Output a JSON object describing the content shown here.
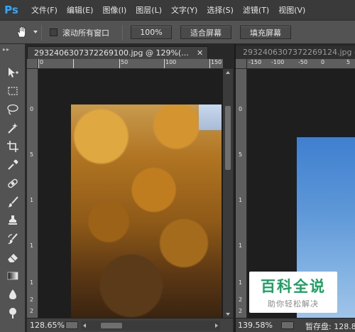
{
  "app": {
    "logo": "Ps"
  },
  "menu": [
    "文件(F)",
    "编辑(E)",
    "图像(I)",
    "图层(L)",
    "文字(Y)",
    "选择(S)",
    "滤镜(T)",
    "视图(V)"
  ],
  "options": {
    "tool_icon": "hand-icon",
    "scroll_all_label": "滚动所有窗口",
    "scroll_all_checked": false,
    "btn_100": "100%",
    "btn_fit": "适合屏幕",
    "btn_fill": "填充屏幕"
  },
  "tools": [
    "move-icon",
    "marquee-icon",
    "lasso-icon",
    "magic-wand-icon",
    "crop-icon",
    "eyedropper-icon",
    "healing-brush-icon",
    "brush-icon",
    "clone-stamp-icon",
    "history-brush-icon",
    "eraser-icon",
    "gradient-icon",
    "blur-icon",
    "dodge-icon"
  ],
  "doc1": {
    "tab_title": "2932406307372269100.jpg @ 129%(...",
    "ruler_h": [
      "0",
      "50",
      "100",
      "150"
    ],
    "ruler_v": [
      "0",
      "5",
      "1",
      "1",
      "1",
      "2",
      "2"
    ],
    "zoom": "128.65%"
  },
  "doc2": {
    "tab_title": "2932406307372269124.jpg @",
    "ruler_h": [
      "-150",
      "-100",
      "-50",
      "0",
      "5"
    ],
    "ruler_v": [
      "0",
      "5",
      "1",
      "1",
      "1",
      "2",
      "2"
    ],
    "zoom": "139.58%",
    "scratch": "暂存盘: 128.8"
  },
  "watermark": {
    "main": "百科全说",
    "sub": "助你轻松解决"
  }
}
